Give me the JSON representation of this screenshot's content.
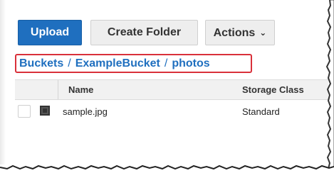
{
  "toolbar": {
    "upload_label": "Upload",
    "create_folder_label": "Create Folder",
    "actions_label": "Actions",
    "actions_chevron": "⌄"
  },
  "breadcrumb": {
    "items": [
      "Buckets",
      "ExampleBucket",
      "photos"
    ],
    "separator": "/"
  },
  "table": {
    "headers": {
      "name": "Name",
      "storage_class": "Storage Class"
    },
    "rows": [
      {
        "name": "sample.jpg",
        "storage_class": "Standard",
        "icon": "file-icon"
      }
    ]
  },
  "colors": {
    "primary": "#1f6fbf",
    "highlight_border": "#d9303a"
  }
}
